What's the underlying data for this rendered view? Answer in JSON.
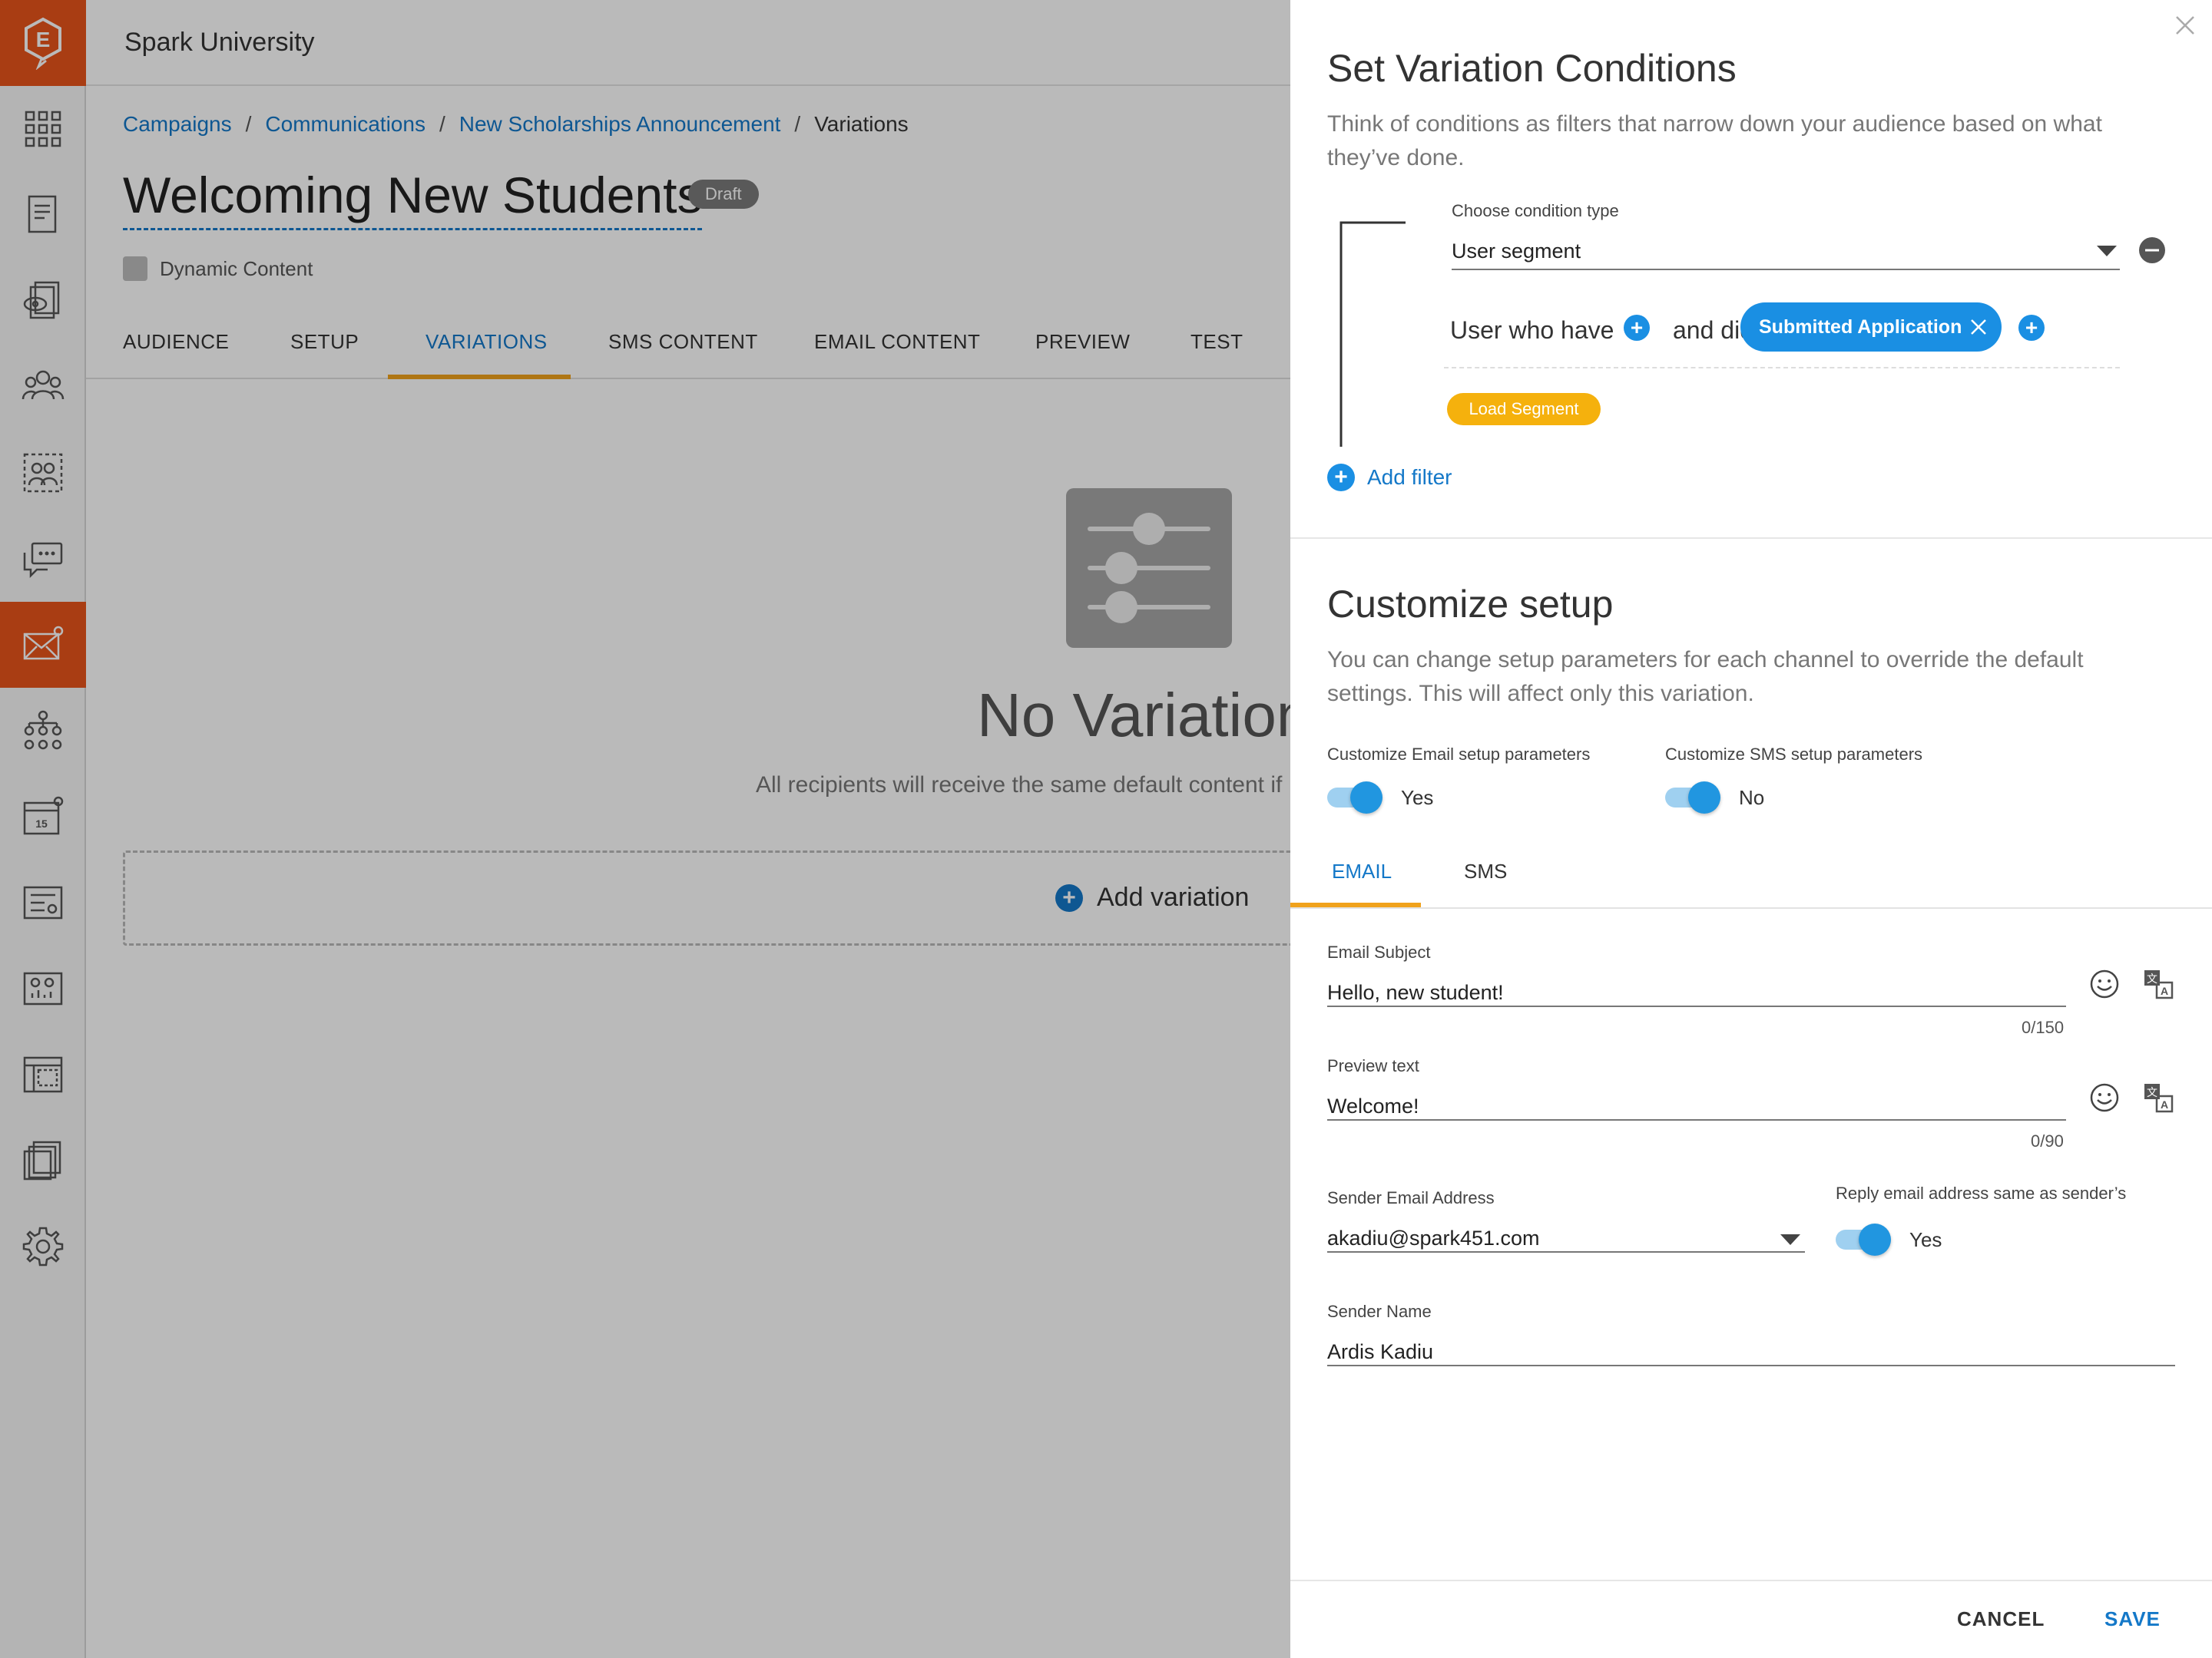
{
  "org_name": "Spark University",
  "sidebar": {
    "logo": "E",
    "items": [
      {
        "icon": "grid-icon"
      },
      {
        "icon": "document-icon"
      },
      {
        "icon": "preview-icon"
      },
      {
        "icon": "users-icon"
      },
      {
        "icon": "segments-icon"
      },
      {
        "icon": "chat-icon"
      },
      {
        "icon": "email-icon",
        "active": true
      },
      {
        "icon": "hierarchy-icon"
      },
      {
        "icon": "calendar-icon",
        "day": "15"
      },
      {
        "icon": "forms-icon"
      },
      {
        "icon": "dashboard-icon"
      },
      {
        "icon": "templates-icon"
      },
      {
        "icon": "files-icon"
      },
      {
        "icon": "gear-icon"
      }
    ]
  },
  "breadcrumb": {
    "links": [
      "Campaigns",
      "Communications",
      "New Scholarships Announcement"
    ],
    "current": "Variations",
    "separator": "/"
  },
  "page": {
    "title": "Welcoming New Students",
    "badge": "Draft",
    "subtitle": "Dynamic Content"
  },
  "tabs": [
    "AUDIENCE",
    "SETUP",
    "VARIATIONS",
    "SMS CONTENT",
    "EMAIL CONTENT",
    "PREVIEW",
    "TEST"
  ],
  "active_tab": "VARIATIONS",
  "empty_state": {
    "title": "No Variation",
    "subtitle": "All recipients will receive the same default content if",
    "add_label": "Add variation"
  },
  "panel": {
    "conditions": {
      "title": "Set Variation Conditions",
      "description": "Think of conditions as filters that narrow down your audience based on what they’ve done.",
      "condition_type_label": "Choose condition type",
      "condition_type_value": "User segment",
      "user_who_have": "User who have",
      "and_did": "and did",
      "chip": "Submitted Application",
      "load_segment": "Load Segment",
      "add_filter": "Add filter"
    },
    "customize": {
      "title": "Customize setup",
      "description": "You can change setup parameters for each channel to override the default settings. This will affect only this variation.",
      "email_toggle_label": "Customize Email setup parameters",
      "email_toggle_value": "Yes",
      "sms_toggle_label": "Customize SMS setup parameters",
      "sms_toggle_value": "No"
    },
    "tabs": [
      "EMAIL",
      "SMS"
    ],
    "active_tab": "EMAIL",
    "fields": {
      "email_subject_label": "Email Subject",
      "email_subject_value": "Hello, new student!",
      "email_subject_counter": "0/150",
      "preview_text_label": "Preview text",
      "preview_text_value": "Welcome!",
      "preview_text_counter": "0/90",
      "sender_email_label": "Sender Email Address",
      "sender_email_value": "akadiu@spark451.com",
      "reply_same_label": "Reply email address same as sender’s",
      "reply_same_value": "Yes",
      "sender_name_label": "Sender Name",
      "sender_name_value": "Ardis Kadiu"
    },
    "footer": {
      "cancel": "CANCEL",
      "save": "SAVE"
    },
    "colors": {
      "accent": "#1478c8",
      "chip": "#1a8fe3",
      "tab_underline": "#f0a21c",
      "load_segment": "#f5b10d",
      "brand": "#e8541b"
    }
  }
}
